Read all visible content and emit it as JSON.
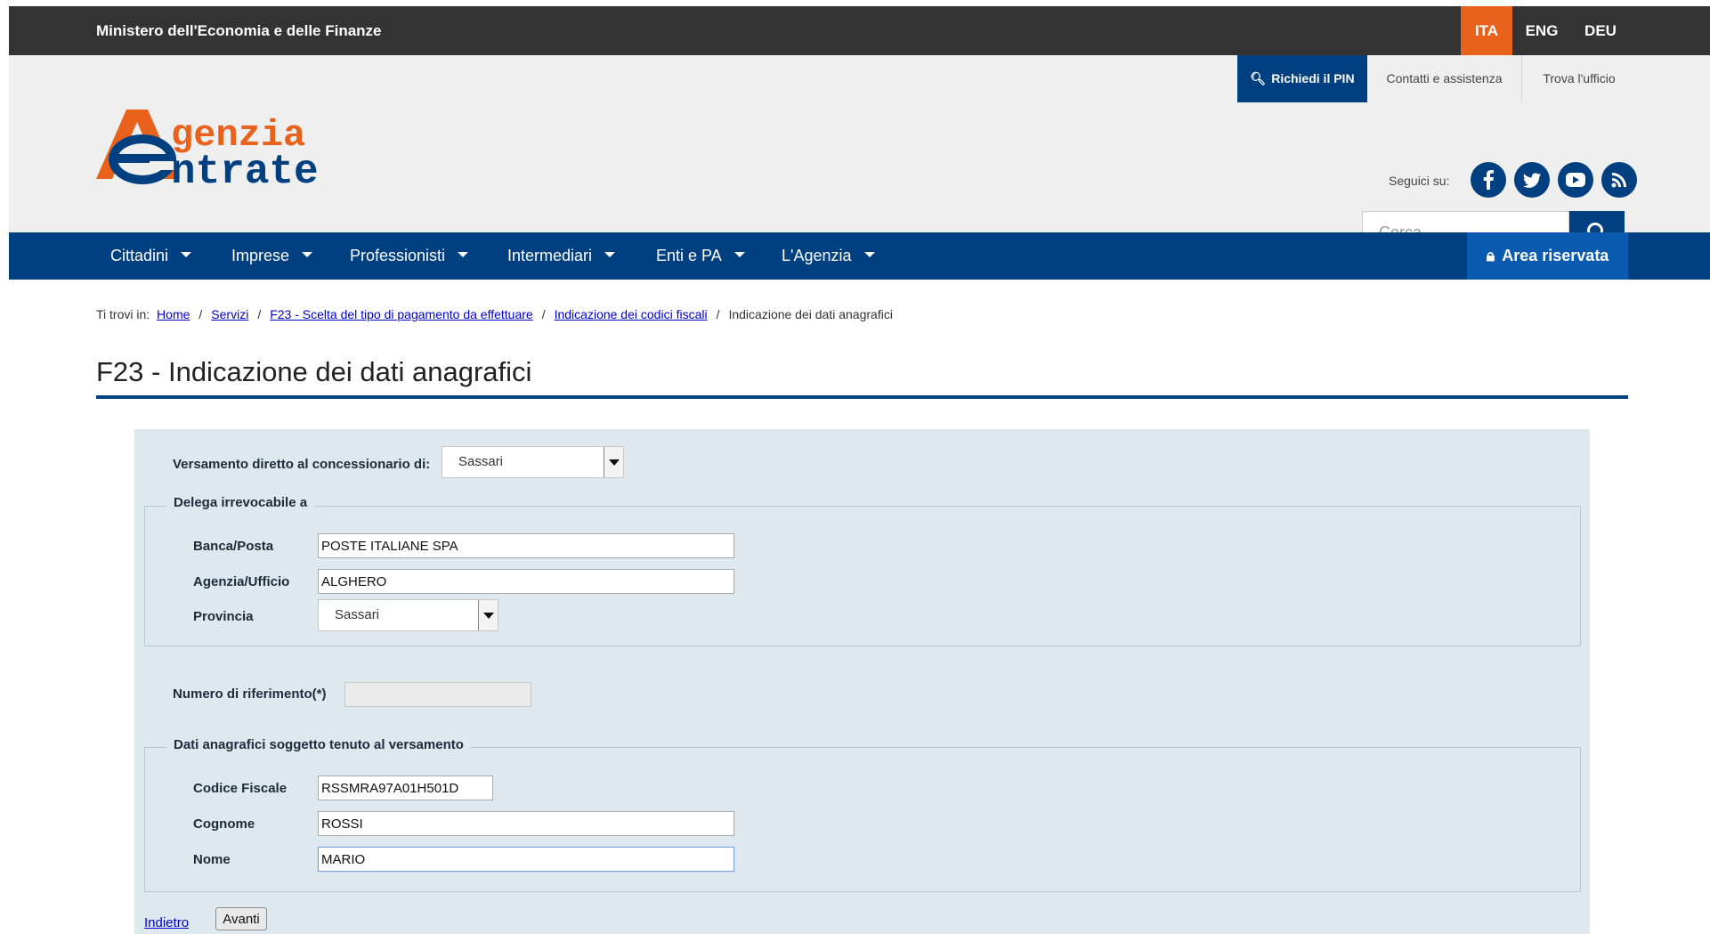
{
  "topbar": {
    "ministry": "Ministero dell'Economia e delle Finanze",
    "languages": [
      "ITA",
      "ENG",
      "DEU"
    ],
    "active_language": "ITA"
  },
  "header": {
    "logo_text_line1": "genzia",
    "logo_text_line2": "ntrate",
    "pin_label": "Richiedi il PIN",
    "contact_label": "Contatti e assistenza",
    "office_label": "Trova l'ufficio",
    "follow_label": "Seguici su:",
    "social": [
      "facebook-icon",
      "twitter-icon",
      "youtube-icon",
      "rss-icon"
    ],
    "search_placeholder": "Cerca..."
  },
  "nav": {
    "items": [
      "Cittadini",
      "Imprese",
      "Professionisti",
      "Intermediari",
      "Enti e PA",
      "L'Agenzia"
    ],
    "reserved_area": "Area riservata"
  },
  "breadcrumb": {
    "prefix": "Ti trovi in:",
    "links": [
      "Home",
      "Servizi",
      "F23 - Scelta del tipo di pagamento da effettuare",
      "Indicazione dei codici fiscali"
    ],
    "current": "Indicazione dei dati anagrafici"
  },
  "page_title": "F23 - Indicazione dei dati anagrafici",
  "form": {
    "concessionario_label": "Versamento diretto al concessionario di:",
    "concessionario_value": "Sassari",
    "delega_legend": "Delega irrevocabile a",
    "banca_label": "Banca/Posta",
    "banca_value": "POSTE ITALIANE SPA",
    "agenzia_label": "Agenzia/Ufficio",
    "agenzia_value": "ALGHERO",
    "provincia_label": "Provincia",
    "provincia_value": "Sassari",
    "numero_label": "Numero di riferimento(*)",
    "numero_value": "",
    "anagrafici_legend": "Dati anagrafici soggetto tenuto al versamento",
    "cf_label": "Codice Fiscale",
    "cf_value": "RSSMRA97A01H501D",
    "cognome_label": "Cognome",
    "cognome_value": "ROSSI",
    "nome_label": "Nome",
    "nome_value": "MARIO",
    "back_label": "Indietro",
    "next_label": "Avanti"
  },
  "colors": {
    "brand_blue": "#003f80",
    "accent_orange": "#e8621d",
    "topbar": "#333333",
    "form_bg": "#dde9ee"
  }
}
